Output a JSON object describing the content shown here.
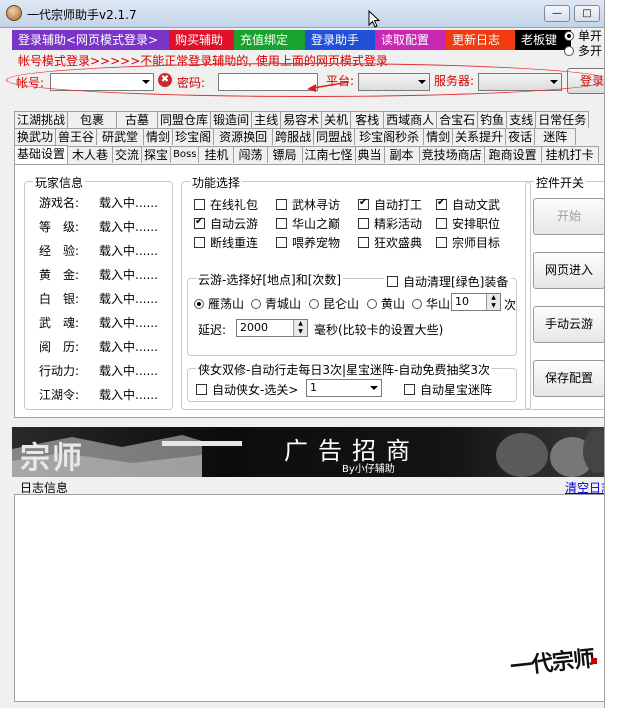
{
  "window": {
    "title": "一代宗师助手v2.1.7",
    "min_glyph": "—",
    "max_glyph": "□"
  },
  "topbar": {
    "buttons": [
      {
        "label": "登录辅助<网页模式登录>",
        "color": "#7b34c8"
      },
      {
        "label": "购买辅助",
        "color": "#e0102a"
      },
      {
        "label": "充值绑定",
        "color": "#18a42c"
      },
      {
        "label": "登录助手",
        "color": "#2050d8"
      },
      {
        "label": "读取配置",
        "color": "#c828b4"
      },
      {
        "label": "更新日志",
        "color": "#f03a10"
      },
      {
        "label": "老板键",
        "color": "#000000"
      }
    ],
    "radios": [
      {
        "label": "单开",
        "checked": true
      },
      {
        "label": "多开",
        "checked": false
      }
    ]
  },
  "notice": "帐号模式登录>>>>>不能正常登录辅助的, 使用上面的网页模式登录",
  "login": {
    "account_label": "帐号:",
    "password_label": "密码:",
    "platform_label": "平台:",
    "server_label": "服务器:",
    "login_button": "登录",
    "key_glyph": "✖"
  },
  "tabs": {
    "row1": [
      "江湖挑战",
      "包裹",
      "古墓",
      "同盟仓库",
      "锻造间",
      "主线",
      "易容术",
      "关机",
      "客栈",
      "西域商人",
      "合宝石",
      "钓鱼",
      "支线",
      "日常任务"
    ],
    "row2": [
      "换武功",
      "兽王谷",
      "研武堂",
      "情剑",
      "珍宝阁",
      "资源换回",
      "跨服战",
      "同盟战",
      "珍宝阁秒杀",
      "情剑",
      "关系提升",
      "夜话",
      "迷阵"
    ],
    "row3": [
      "基础设置",
      "木人巷",
      "交流",
      "探宝",
      "Boss",
      "挂机",
      "闯荡",
      "镖局",
      "江南七怪",
      "典当",
      "副本",
      "竞技场商店",
      "跑商设置",
      "挂机打卡"
    ],
    "active": "基础设置"
  },
  "player_info": {
    "title": "玩家信息",
    "rows": [
      {
        "key": "游戏名:",
        "value": "载入中......"
      },
      {
        "key": "等　级:",
        "value": "载入中......"
      },
      {
        "key": "经　验:",
        "value": "载入中......"
      },
      {
        "key": "黄　金:",
        "value": "载入中......"
      },
      {
        "key": "白　银:",
        "value": "载入中......"
      },
      {
        "key": "武　魂:",
        "value": "载入中......"
      },
      {
        "key": "阅　历:",
        "value": "载入中......"
      },
      {
        "key": "行动力:",
        "value": "载入中......"
      },
      {
        "key": "江湖令:",
        "value": "载入中......"
      }
    ]
  },
  "features": {
    "title": "功能选择",
    "items": [
      {
        "label": "在线礼包",
        "checked": false
      },
      {
        "label": "武林寻访",
        "checked": false
      },
      {
        "label": "自动打工",
        "checked": true
      },
      {
        "label": "自动文武",
        "checked": true
      },
      {
        "label": "自动云游",
        "checked": true
      },
      {
        "label": "华山之巅",
        "checked": false
      },
      {
        "label": "精彩活动",
        "checked": false
      },
      {
        "label": "安排职位",
        "checked": false
      },
      {
        "label": "断线重连",
        "checked": false
      },
      {
        "label": "喂养宠物",
        "checked": false
      },
      {
        "label": "狂欢盛典",
        "checked": false
      },
      {
        "label": "宗师目标",
        "checked": false
      }
    ]
  },
  "travel": {
    "title": "云游-选择好[地点]和[次数]",
    "auto_clean_label": "自动清理[绿色]装备",
    "auto_clean_checked": false,
    "places": [
      {
        "label": "雁荡山",
        "checked": true
      },
      {
        "label": "青城山",
        "checked": false
      },
      {
        "label": "昆仑山",
        "checked": false
      },
      {
        "label": "黄山",
        "checked": false
      },
      {
        "label": "华山",
        "checked": false
      }
    ],
    "count": "10",
    "count_unit": "次",
    "delay_label": "延迟:",
    "delay_value": "2000",
    "delay_unit": "毫秒(比较卡的设置大些)"
  },
  "hero": {
    "title": "侠女双修-自动行走每日3次|星宝迷阵-自动免费抽奖3次",
    "auto_hero_label": "自动侠女-选关>",
    "auto_hero_checked": false,
    "level_value": "1",
    "star_maze_label": "自动星宝迷阵",
    "star_maze_checked": false
  },
  "controls": {
    "title": "控件开关",
    "buttons": [
      {
        "label": "开始",
        "enabled": false
      },
      {
        "label": "网页进入",
        "enabled": true
      },
      {
        "label": "手动云游",
        "enabled": true
      },
      {
        "label": "保存配置",
        "enabled": true
      }
    ]
  },
  "banner": {
    "left_text": "宗师",
    "center_text": "广告招商",
    "sub_text": "By小仔辅助"
  },
  "log": {
    "title": "日志信息",
    "clear_link": "清空日志"
  },
  "watermark": "一代宗师"
}
